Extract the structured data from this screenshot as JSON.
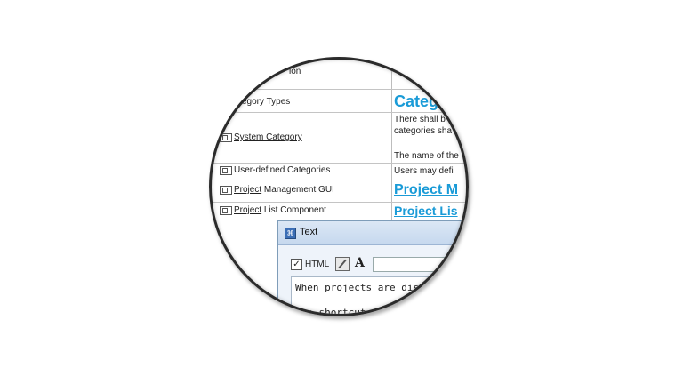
{
  "table": {
    "rows": [
      {
        "left": "ion",
        "right": ""
      },
      {
        "left": "egory Types",
        "right": "Categ"
      },
      {
        "left_link": "System Category",
        "right_line1": "There shall b",
        "right_line2": "categories sha",
        "right_line3": "The name of the"
      },
      {
        "left": "User-defined Categories",
        "right": "Users may defi"
      },
      {
        "left_link": "Project",
        "left_rest": " Management GUI",
        "right": "Project M"
      },
      {
        "left_link": "Project",
        "left_rest": " List Component",
        "right": "Project Lis"
      }
    ]
  },
  "dialog": {
    "title": "Text",
    "html_checkbox_label": "HTML",
    "html_checked": "✓",
    "font_button": "A",
    "text_line1": "When projects are displayed",
    "text_line2": "The shortcut men"
  },
  "colors": {
    "accent": "#1a9bd7",
    "ring": "#2b2b2b"
  }
}
